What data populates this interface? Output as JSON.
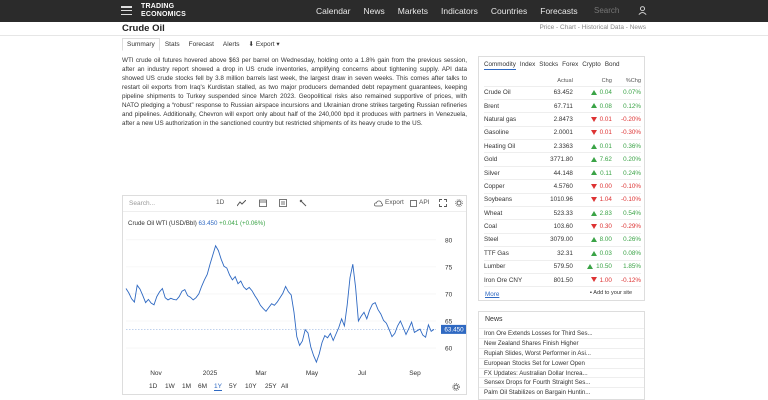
{
  "brand": {
    "line1": "TRADING",
    "line2": "ECONOMICS"
  },
  "nav": [
    "Calendar",
    "News",
    "Markets",
    "Indicators",
    "Countries",
    "Forecasts"
  ],
  "search_placeholder": "Search",
  "page_title": "Crude Oil",
  "breadcrumb": "Price - Chart - Historical Data - News",
  "tabs": [
    "Summary",
    "Stats",
    "Forecast",
    "Alerts",
    "Export"
  ],
  "article": "WTI crude oil futures hovered above $63 per barrel on Wednesday, holding onto a 1.8% gain from the previous session, after an industry report showed a drop in US crude inventories, amplifying concerns about tightening supply. API data showed US crude stocks fell by 3.8 million barrels last week, the largest draw in seven weeks. This comes after talks to restart oil exports from Iraq's Kurdistan stalled, as two major producers demanded debt repayment guarantees, keeping pipeline shipments to Turkey suspended since March 2023. Geopolitical risks also remained supportive of prices, with NATO pledging a “robust” response to Russian airspace incursions and Ukrainian drone strikes targeting Russian refineries and pipelines. Additionally, Chevron will export only about half of the 240,000 bpd it produces with partners in Venezuela, after a new US authorization in the sanctioned country but restricted shipments of its heavy crude to the US.",
  "chart_toolbar": {
    "search": "Search...",
    "period": "1D",
    "export": "Export",
    "api": "API"
  },
  "chart_legend": {
    "label": "Crude Oil WTI (USD/Bbl)",
    "price": "63.450",
    "change": "+0.041 (+0.06%)"
  },
  "chart_data": {
    "type": "line",
    "title": "Crude Oil WTI (USD/Bbl)",
    "x_ticks": [
      "Nov",
      "2025",
      "Mar",
      "May",
      "Jul",
      "Sep"
    ],
    "y_ticks": [
      60,
      65,
      70,
      75,
      80
    ],
    "ylim": [
      56.5,
      82
    ],
    "last_value": 63.45,
    "series": [
      {
        "name": "Crude Oil WTI (USD/Bbl)",
        "values": [
          71.0,
          70.2,
          69.1,
          68.5,
          71.6,
          70.9,
          69.7,
          68.4,
          69.0,
          68.3,
          68.0,
          69.5,
          70.4,
          71.0,
          69.3,
          68.9,
          69.2,
          69.0,
          68.9,
          69.5,
          70.5,
          70.8,
          69.7,
          69.4,
          68.9,
          69.3,
          70.0,
          71.4,
          72.6,
          73.6,
          75.5,
          77.2,
          78.9,
          78.0,
          76.4,
          75.1,
          74.8,
          73.5,
          72.6,
          73.2,
          71.9,
          72.4,
          71.3,
          70.8,
          71.2,
          70.6,
          69.7,
          68.9,
          67.9,
          67.3,
          66.8,
          67.5,
          68.2,
          67.9,
          68.5,
          69.3,
          70.1,
          71.4,
          70.4,
          69.8,
          66.6,
          62.1,
          60.5,
          61.3,
          63.4,
          62.8,
          60.2,
          58.6,
          57.4,
          58.9,
          61.0,
          62.3,
          61.9,
          62.7,
          61.4,
          62.6,
          63.8,
          65.4,
          64.1,
          68.0,
          73.0,
          75.5,
          71.2,
          65.0,
          65.9,
          66.6,
          65.4,
          67.0,
          68.1,
          68.4,
          67.1,
          66.3,
          65.1,
          64.6,
          63.4,
          62.1,
          62.7,
          64.1,
          65.0,
          63.8,
          62.5,
          63.6,
          64.8,
          62.9,
          63.2,
          63.5,
          62.4,
          62.0,
          64.3,
          63.1,
          63.45
        ]
      }
    ],
    "range_buttons": [
      "1D",
      "1W",
      "1M",
      "6M",
      "1Y",
      "5Y",
      "10Y",
      "25Y",
      "All"
    ],
    "active_range": "1Y"
  },
  "commodity_tabs": [
    "Commodity",
    "Index",
    "Stocks",
    "Forex",
    "Crypto",
    "Bond"
  ],
  "table_headers": [
    "",
    "Actual",
    "Chg",
    "%Chg"
  ],
  "commodities": [
    {
      "name": "Crude Oil",
      "actual": "63.452",
      "chg": "0.04",
      "pct": "0.07%",
      "dir": "up"
    },
    {
      "name": "Brent",
      "actual": "67.711",
      "chg": "0.08",
      "pct": "0.12%",
      "dir": "up"
    },
    {
      "name": "Natural gas",
      "actual": "2.8473",
      "chg": "0.01",
      "pct": "-0.20%",
      "dir": "down"
    },
    {
      "name": "Gasoline",
      "actual": "2.0001",
      "chg": "0.01",
      "pct": "-0.30%",
      "dir": "down"
    },
    {
      "name": "Heating Oil",
      "actual": "2.3363",
      "chg": "0.01",
      "pct": "0.36%",
      "dir": "up"
    },
    {
      "name": "Gold",
      "actual": "3771.80",
      "chg": "7.62",
      "pct": "0.20%",
      "dir": "up"
    },
    {
      "name": "Silver",
      "actual": "44.148",
      "chg": "0.11",
      "pct": "0.24%",
      "dir": "up"
    },
    {
      "name": "Copper",
      "actual": "4.5760",
      "chg": "0.00",
      "pct": "-0.10%",
      "dir": "down"
    },
    {
      "name": "Soybeans",
      "actual": "1010.96",
      "chg": "1.04",
      "pct": "-0.10%",
      "dir": "down"
    },
    {
      "name": "Wheat",
      "actual": "523.33",
      "chg": "2.83",
      "pct": "0.54%",
      "dir": "up"
    },
    {
      "name": "Coal",
      "actual": "103.60",
      "chg": "0.30",
      "pct": "-0.29%",
      "dir": "down"
    },
    {
      "name": "Steel",
      "actual": "3079.00",
      "chg": "8.00",
      "pct": "0.26%",
      "dir": "up"
    },
    {
      "name": "TTF Gas",
      "actual": "32.31",
      "chg": "0.03",
      "pct": "0.08%",
      "dir": "up"
    },
    {
      "name": "Lumber",
      "actual": "579.50",
      "chg": "10.50",
      "pct": "1.85%",
      "dir": "up"
    },
    {
      "name": "Iron Ore CNY",
      "actual": "801.50",
      "chg": "1.00",
      "pct": "-0.12%",
      "dir": "down"
    }
  ],
  "more_label": "More",
  "add_to_site": "Add to your site",
  "news_title": "News",
  "news": [
    "Iron Ore Extends Losses for Third Ses...",
    "New Zealand Shares Finish Higher",
    "Rupiah Slides, Worst Performer in Asi...",
    "European Stocks Set for Lower Open",
    "FX Updates: Australian Dollar Increa...",
    "Sensex Drops for Fourth Straight Ses...",
    "Palm Oil Stabilizes on Bargain Huntin..."
  ],
  "colors": {
    "topbar": "#2b2b2b",
    "accent": "#2f69c2",
    "up": "#3aa346",
    "down": "#dd3333"
  }
}
